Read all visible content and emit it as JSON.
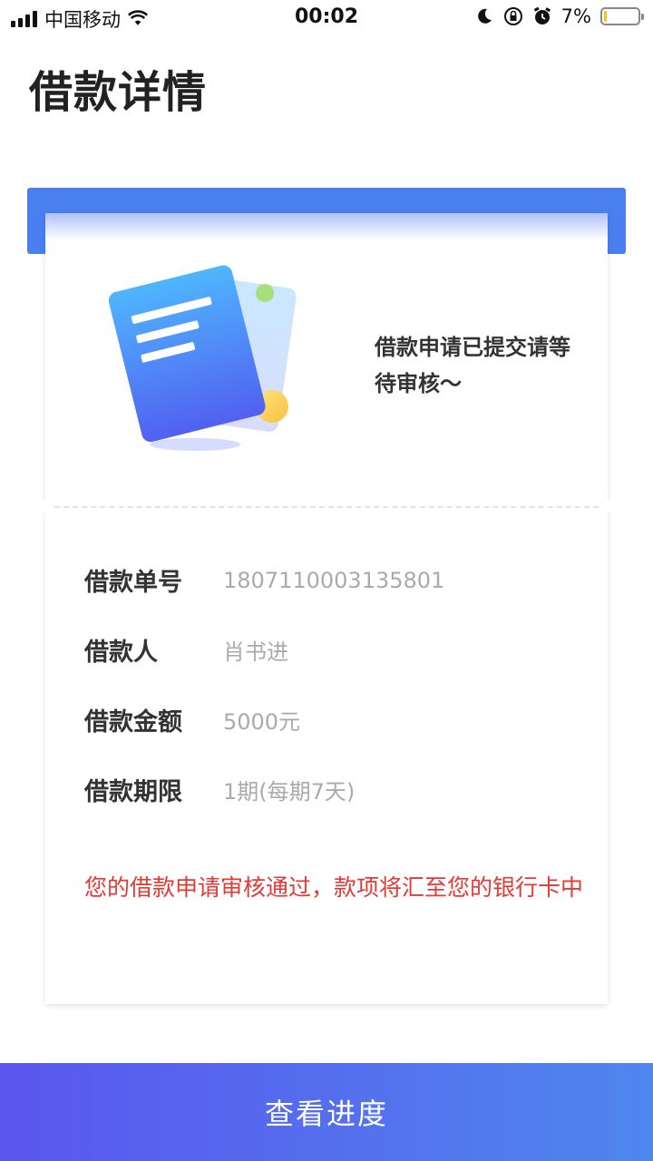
{
  "status_bar": {
    "carrier": "中国移动",
    "time": "00:02",
    "battery_percent_text": "7%",
    "battery_level": 0.07,
    "icons": [
      "signal-icon",
      "wifi-icon",
      "moon-icon",
      "rotation-lock-icon",
      "alarm-icon",
      "battery-icon"
    ]
  },
  "page": {
    "title": "借款详情"
  },
  "card": {
    "status_message": "借款申请已提交请等待审核～",
    "fields": [
      {
        "label": "借款单号",
        "value": "1807110003135801"
      },
      {
        "label": "借款人",
        "value": "肖书进"
      },
      {
        "label": "借款金额",
        "value": "5000元"
      },
      {
        "label": "借款期限",
        "value": "1期(每期7天)"
      }
    ],
    "notice": "您的借款申请审核通过，款项将汇至您的银行卡中"
  },
  "footer": {
    "button_label": "查看进度"
  },
  "colors": {
    "accent_blue": "#4a7ff0",
    "notice_red": "#e53935",
    "button_gradient_start": "#5a56ee",
    "button_gradient_end": "#4f86ee"
  }
}
